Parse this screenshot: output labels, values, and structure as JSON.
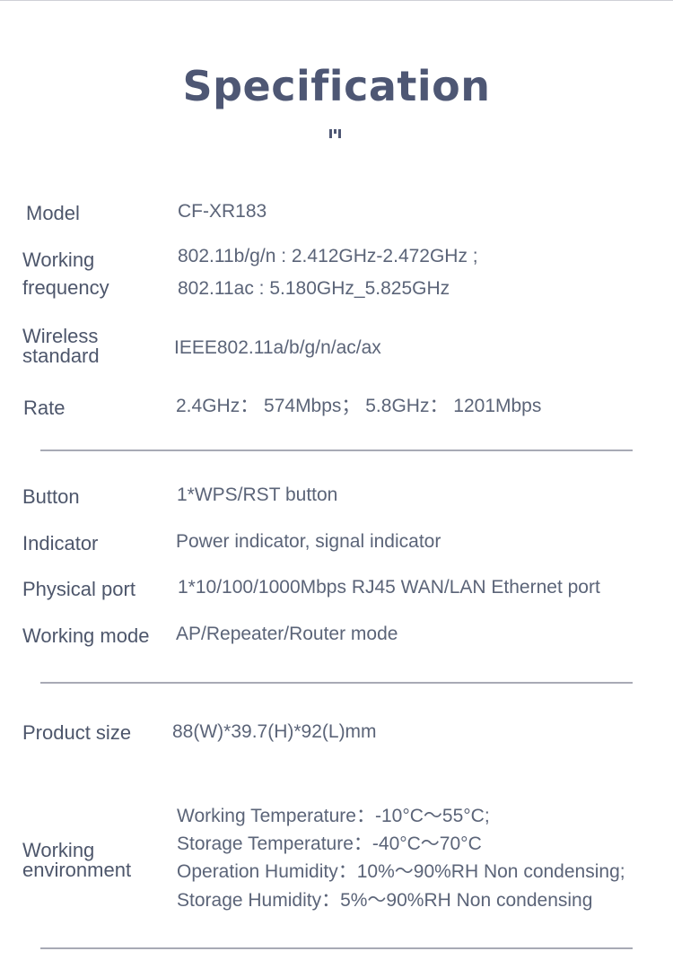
{
  "title": "Specification",
  "specs": {
    "model": {
      "label": "Model",
      "value": "CF-XR183"
    },
    "working_frequency": {
      "label_line1": "Working",
      "label_line2": "frequency",
      "values": [
        "802.11b/g/n : 2.412GHz-2.472GHz ;",
        "802.11ac : 5.180GHz_5.825GHz"
      ]
    },
    "wireless_standard": {
      "label_line1": "Wireless",
      "label_line2": "standard",
      "value": "IEEE802.11a/b/g/n/ac/ax"
    },
    "rate": {
      "label": "Rate",
      "value": "2.4GHz： 574Mbps；  5.8GHz： 1201Mbps"
    },
    "button": {
      "label": "Button",
      "value": "1*WPS/RST button"
    },
    "indicator": {
      "label": "Indicator",
      "value": "Power indicator, signal indicator"
    },
    "physical_port": {
      "label": "Physical port",
      "value": "1*10/100/1000Mbps RJ45 WAN/LAN Ethernet port"
    },
    "working_mode": {
      "label": "Working mode",
      "value": "AP/Repeater/Router mode"
    },
    "product_size": {
      "label": "Product size",
      "value": "88(W)*39.7(H)*92(L)mm"
    },
    "working_environment": {
      "label_line1": "Working",
      "label_line2": "environment",
      "values": [
        "Working Temperature：-10°C～55°C;",
        "Storage Temperature：-40°C～70°C",
        "Operation Humidity：10%～90%RH Non condensing;",
        "Storage Humidity：5%～90%RH Non condensing"
      ]
    }
  }
}
